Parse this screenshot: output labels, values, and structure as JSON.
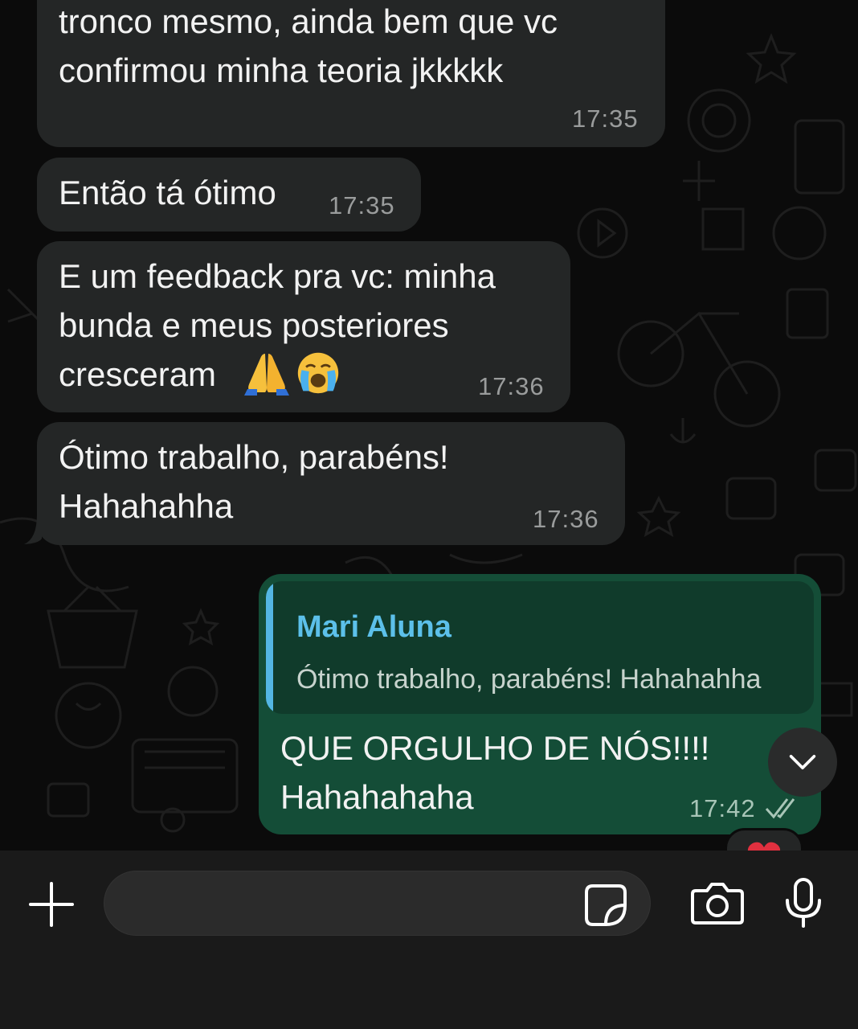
{
  "messages": [
    {
      "direction": "incoming",
      "text": "tronco mesmo, ainda bem que vc\nconfirmou minha teoria jkkkkk",
      "time": "17:35"
    },
    {
      "direction": "incoming",
      "text": "Então tá ótimo",
      "time": "17:35"
    },
    {
      "direction": "incoming",
      "text": "E um feedback pra vc: minha\nbunda e meus posteriores\ncresceram",
      "emojis": [
        "folded-hands-emoji",
        "loudly-crying-face-emoji"
      ],
      "time": "17:36"
    },
    {
      "direction": "incoming",
      "text": "Ótimo trabalho, parabéns!\nHahahahha",
      "time": "17:36"
    },
    {
      "direction": "outgoing",
      "quote": {
        "author": "Mari Aluna",
        "text": "Ótimo trabalho, parabéns! Hahahahha"
      },
      "text": "QUE ORGULHO DE NÓS!!!!\nHahahahaha",
      "time": "17:42",
      "status": "read"
    }
  ],
  "reaction": "heart",
  "composer": {
    "placeholder": "",
    "icons": [
      "plus-icon",
      "sticker-icon",
      "camera-icon",
      "microphone-icon"
    ]
  },
  "colors": {
    "background": "#0b0b0b",
    "incoming_bubble": "#242626",
    "outgoing_bubble": "#144d37",
    "quote_accent": "#54b6e3",
    "read_check": "#a8c5b7"
  }
}
